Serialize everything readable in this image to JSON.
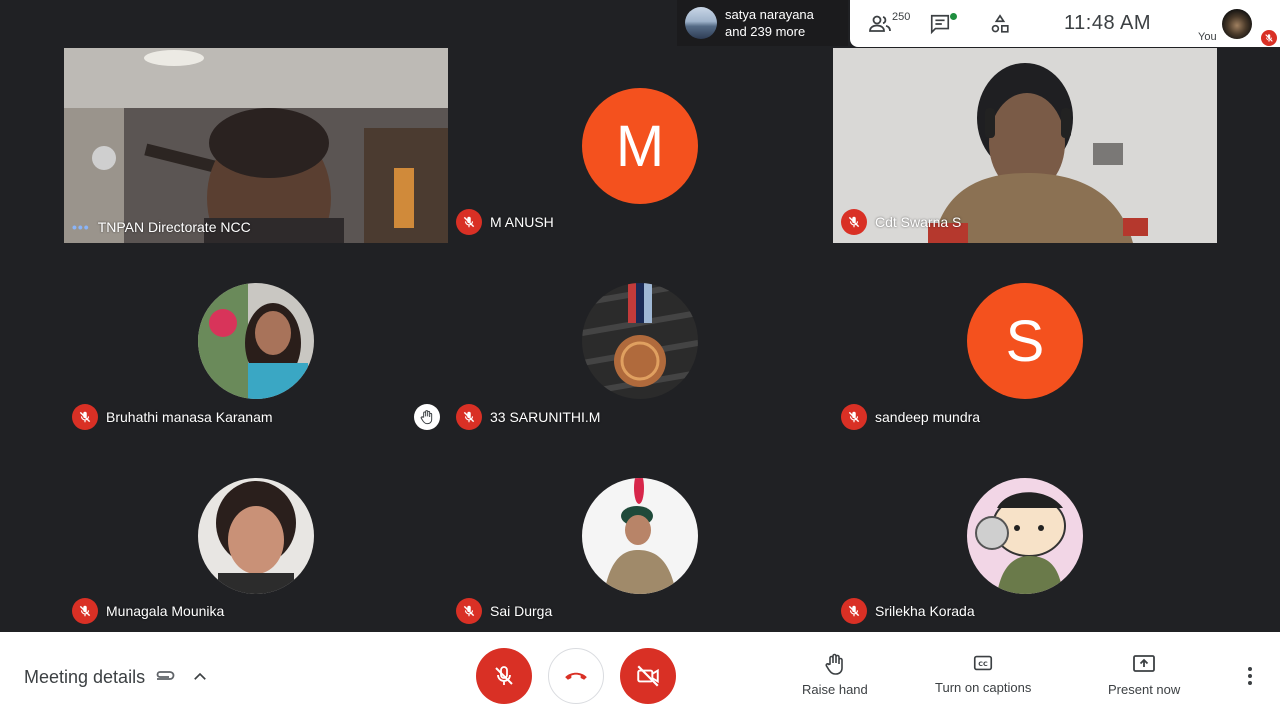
{
  "presenter": {
    "line1": "satya narayana",
    "line2": "and 239 more"
  },
  "toolbar": {
    "participant_count": "250",
    "time": "11:48  AM",
    "you_label": "You"
  },
  "tiles": [
    {
      "name": "TNPAN Directorate NCC",
      "type": "video",
      "muted": false,
      "speaking": true
    },
    {
      "name": "M ANUSH",
      "type": "letter",
      "letter": "M",
      "muted": true
    },
    {
      "name": "Cdt Swarna S",
      "type": "video",
      "muted": true
    },
    {
      "name": "Bruhathi manasa Karanam",
      "type": "photo",
      "muted": true,
      "hand_raised": true
    },
    {
      "name": "33 SARUNITHI.M",
      "type": "photo",
      "muted": true
    },
    {
      "name": "sandeep mundra",
      "type": "letter",
      "letter": "S",
      "muted": true
    },
    {
      "name": "Munagala Mounika",
      "type": "photo",
      "muted": true
    },
    {
      "name": "Sai Durga",
      "type": "photo",
      "muted": true
    },
    {
      "name": "Srilekha Korada",
      "type": "photo",
      "muted": true
    }
  ],
  "bottom": {
    "meeting_details": "Meeting details",
    "raise_hand": "Raise hand",
    "captions": "Turn on captions",
    "present": "Present now"
  },
  "colors": {
    "mute_red": "#d93025",
    "avatar_orange": "#f4511e",
    "background": "#202124"
  },
  "icons": [
    "people-icon",
    "chat-icon",
    "activities-icon",
    "mic-off-icon",
    "hang-up-icon",
    "camera-off-icon",
    "hand-icon",
    "captions-icon",
    "present-icon",
    "more-vert-icon",
    "attachment-icon",
    "chevron-up-icon"
  ]
}
